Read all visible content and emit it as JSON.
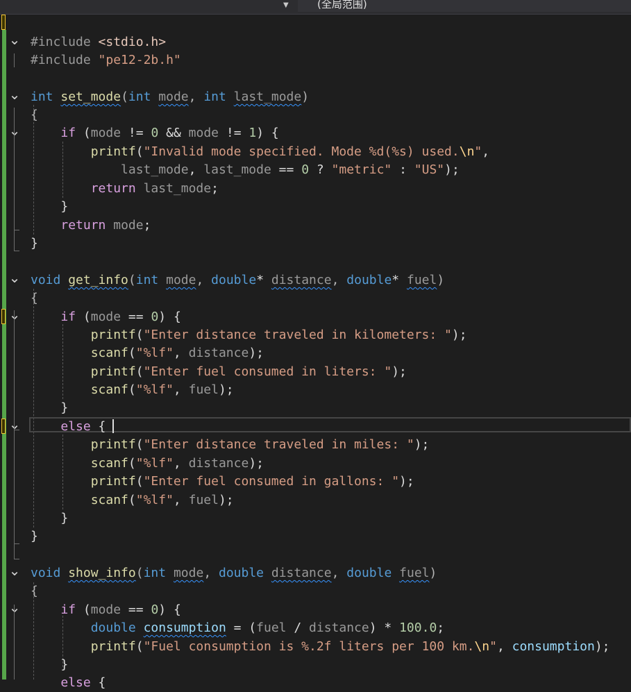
{
  "header": {
    "scope_label": "(全局范围)",
    "dropdown_icon": "chevron-down-icon"
  },
  "colors": {
    "background": "#1e1e1e",
    "keyword": "#569cd6",
    "control": "#d8a0df",
    "function": "#dcdcaa",
    "string": "#d69d85",
    "number": "#b5cea8",
    "change_bar": "#57a64a"
  },
  "code": {
    "include_stdio": "#include <stdio.h>",
    "include_header": "#include \"pe12-2b.h\"",
    "lines": [
      [
        [
          "kw",
          "int"
        ],
        [
          "plain",
          " "
        ],
        [
          "fn sq",
          "set_mode"
        ],
        [
          "punc",
          "("
        ],
        [
          "kw",
          "int"
        ],
        [
          "plain",
          " "
        ],
        [
          "param sq",
          "mode"
        ],
        [
          "punc",
          ", "
        ],
        [
          "kw",
          "int"
        ],
        [
          "plain",
          " "
        ],
        [
          "param sq",
          "last_mode"
        ],
        [
          "punc",
          ")"
        ]
      ],
      [
        [
          "punc",
          "{"
        ]
      ],
      [
        [
          "plain",
          "    "
        ],
        [
          "ctl",
          "if"
        ],
        [
          "plain",
          " ("
        ],
        [
          "param",
          "mode"
        ],
        [
          "plain",
          " != "
        ],
        [
          "num",
          "0"
        ],
        [
          "plain",
          " && "
        ],
        [
          "param",
          "mode"
        ],
        [
          "plain",
          " != "
        ],
        [
          "num",
          "1"
        ],
        [
          "plain",
          ") {"
        ]
      ],
      [
        [
          "plain",
          "        "
        ],
        [
          "fn",
          "printf"
        ],
        [
          "plain",
          "("
        ],
        [
          "str",
          "\"Invalid mode specified. Mode %d(%s) used."
        ],
        [
          "esc",
          "\\n"
        ],
        [
          "str",
          "\""
        ],
        [
          "plain",
          ","
        ]
      ],
      [
        [
          "plain",
          "            "
        ],
        [
          "param",
          "last_mode"
        ],
        [
          "plain",
          ", "
        ],
        [
          "param",
          "last_mode"
        ],
        [
          "plain",
          " == "
        ],
        [
          "num",
          "0"
        ],
        [
          "plain",
          " ? "
        ],
        [
          "str",
          "\"metric\""
        ],
        [
          "plain",
          " : "
        ],
        [
          "str",
          "\"US\""
        ],
        [
          "plain",
          ");"
        ]
      ],
      [
        [
          "plain",
          "        "
        ],
        [
          "ctl",
          "return"
        ],
        [
          "plain",
          " "
        ],
        [
          "param",
          "last_mode"
        ],
        [
          "plain",
          ";"
        ]
      ],
      [
        [
          "plain",
          "    }"
        ]
      ],
      [
        [
          "plain",
          "    "
        ],
        [
          "ctl",
          "return"
        ],
        [
          "plain",
          " "
        ],
        [
          "param",
          "mode"
        ],
        [
          "plain",
          ";"
        ]
      ],
      [
        [
          "plain",
          "}"
        ]
      ],
      [
        [
          "kw",
          "void"
        ],
        [
          "plain",
          " "
        ],
        [
          "fn sq",
          "get_info"
        ],
        [
          "punc",
          "("
        ],
        [
          "kw",
          "int"
        ],
        [
          "plain",
          " "
        ],
        [
          "param sq",
          "mode"
        ],
        [
          "punc",
          ", "
        ],
        [
          "kw",
          "double"
        ],
        [
          "plain",
          "* "
        ],
        [
          "param sq",
          "distance"
        ],
        [
          "punc",
          ", "
        ],
        [
          "kw",
          "double"
        ],
        [
          "plain",
          "* "
        ],
        [
          "param sq",
          "fuel"
        ],
        [
          "punc",
          ")"
        ]
      ],
      [
        [
          "punc",
          "{"
        ]
      ],
      [
        [
          "plain",
          "    "
        ],
        [
          "ctl",
          "if"
        ],
        [
          "plain",
          " ("
        ],
        [
          "param",
          "mode"
        ],
        [
          "plain",
          " == "
        ],
        [
          "num",
          "0"
        ],
        [
          "plain",
          ") {"
        ]
      ],
      [
        [
          "plain",
          "        "
        ],
        [
          "fn",
          "printf"
        ],
        [
          "plain",
          "("
        ],
        [
          "str",
          "\"Enter distance traveled in kilometers: \""
        ],
        [
          "plain",
          ");"
        ]
      ],
      [
        [
          "plain",
          "        "
        ],
        [
          "fn",
          "scanf"
        ],
        [
          "plain",
          "("
        ],
        [
          "str",
          "\"%lf\""
        ],
        [
          "plain",
          ", "
        ],
        [
          "param",
          "distance"
        ],
        [
          "plain",
          ");"
        ]
      ],
      [
        [
          "plain",
          "        "
        ],
        [
          "fn",
          "printf"
        ],
        [
          "plain",
          "("
        ],
        [
          "str",
          "\"Enter fuel consumed in liters: \""
        ],
        [
          "plain",
          ");"
        ]
      ],
      [
        [
          "plain",
          "        "
        ],
        [
          "fn",
          "scanf"
        ],
        [
          "plain",
          "("
        ],
        [
          "str",
          "\"%lf\""
        ],
        [
          "plain",
          ", "
        ],
        [
          "param",
          "fuel"
        ],
        [
          "plain",
          ");"
        ]
      ],
      [
        [
          "plain",
          "    }"
        ]
      ],
      [
        [
          "plain",
          "    "
        ],
        [
          "ctl",
          "else"
        ],
        [
          "plain",
          " { "
        ]
      ],
      [
        [
          "plain",
          "        "
        ],
        [
          "fn",
          "printf"
        ],
        [
          "plain",
          "("
        ],
        [
          "str",
          "\"Enter distance traveled in miles: \""
        ],
        [
          "plain",
          ");"
        ]
      ],
      [
        [
          "plain",
          "        "
        ],
        [
          "fn",
          "scanf"
        ],
        [
          "plain",
          "("
        ],
        [
          "str",
          "\"%lf\""
        ],
        [
          "plain",
          ", "
        ],
        [
          "param",
          "distance"
        ],
        [
          "plain",
          ");"
        ]
      ],
      [
        [
          "plain",
          "        "
        ],
        [
          "fn",
          "printf"
        ],
        [
          "plain",
          "("
        ],
        [
          "str",
          "\"Enter fuel consumed in gallons: \""
        ],
        [
          "plain",
          ");"
        ]
      ],
      [
        [
          "plain",
          "        "
        ],
        [
          "fn",
          "scanf"
        ],
        [
          "plain",
          "("
        ],
        [
          "str",
          "\"%lf\""
        ],
        [
          "plain",
          ", "
        ],
        [
          "param",
          "fuel"
        ],
        [
          "plain",
          ");"
        ]
      ],
      [
        [
          "plain",
          "    }"
        ]
      ],
      [
        [
          "plain",
          "}"
        ]
      ],
      [
        [
          "kw",
          "void"
        ],
        [
          "plain",
          " "
        ],
        [
          "fn sq",
          "show_info"
        ],
        [
          "punc",
          "("
        ],
        [
          "kw",
          "int"
        ],
        [
          "plain",
          " "
        ],
        [
          "param sq",
          "mode"
        ],
        [
          "punc",
          ", "
        ],
        [
          "kw",
          "double"
        ],
        [
          "plain",
          " "
        ],
        [
          "param sq",
          "distance"
        ],
        [
          "punc",
          ", "
        ],
        [
          "kw",
          "double"
        ],
        [
          "plain",
          " "
        ],
        [
          "param sq",
          "fuel"
        ],
        [
          "punc",
          ")"
        ]
      ],
      [
        [
          "punc",
          "{"
        ]
      ],
      [
        [
          "plain",
          "    "
        ],
        [
          "ctl",
          "if"
        ],
        [
          "plain",
          " ("
        ],
        [
          "param",
          "mode"
        ],
        [
          "plain",
          " == "
        ],
        [
          "num",
          "0"
        ],
        [
          "plain",
          ") {"
        ]
      ],
      [
        [
          "plain",
          "        "
        ],
        [
          "kw",
          "double"
        ],
        [
          "plain",
          " "
        ],
        [
          "var sq",
          "consumption"
        ],
        [
          "plain",
          " = ("
        ],
        [
          "param",
          "fuel"
        ],
        [
          "plain",
          " / "
        ],
        [
          "param",
          "distance"
        ],
        [
          "plain",
          ") * "
        ],
        [
          "num",
          "100.0"
        ],
        [
          "plain",
          ";"
        ]
      ],
      [
        [
          "plain",
          "        "
        ],
        [
          "fn",
          "printf"
        ],
        [
          "plain",
          "("
        ],
        [
          "str",
          "\"Fuel consumption is %.2f liters per 100 km."
        ],
        [
          "esc",
          "\\n"
        ],
        [
          "str",
          "\""
        ],
        [
          "plain",
          ", "
        ],
        [
          "var",
          "consumption"
        ],
        [
          "plain",
          ");"
        ]
      ],
      [
        [
          "plain",
          "    }"
        ]
      ],
      [
        [
          "plain",
          "    "
        ],
        [
          "ctl",
          "else"
        ],
        [
          "plain",
          " {"
        ]
      ]
    ]
  }
}
